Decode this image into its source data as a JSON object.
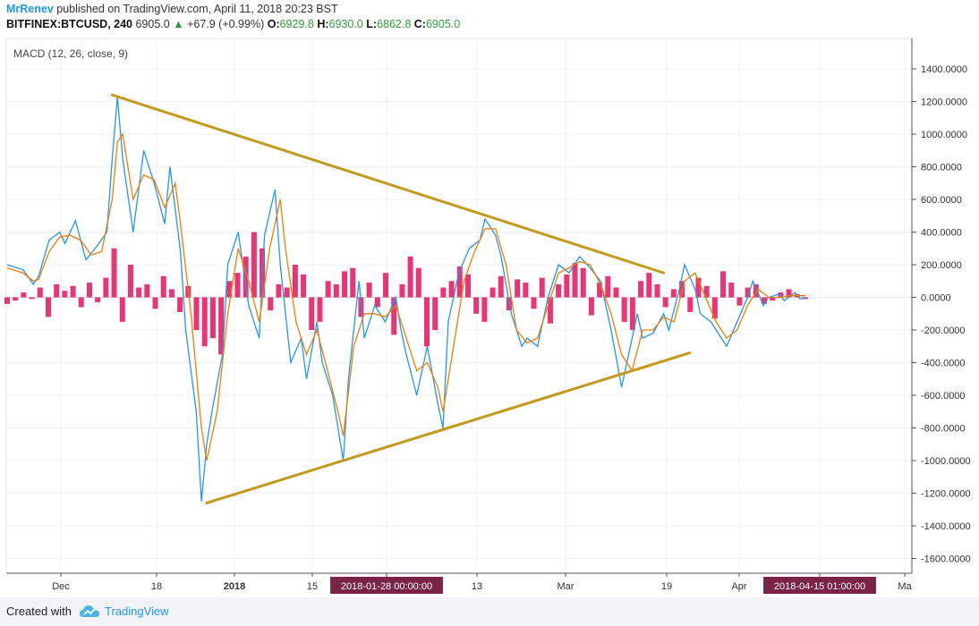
{
  "header": {
    "author": "MrRenev",
    "published": "published on TradingView.com, April 11, 2018 20:23 BST",
    "symbol": "BITFINEX:BTCUSD, 240",
    "last": "6905.0",
    "change": "+67.9 (+0.99%)",
    "o_label": "O:",
    "o": "6929.8",
    "h_label": "H:",
    "h": "6930.0",
    "l_label": "L:",
    "l": "6862.8",
    "c_label": "C:",
    "c": "6905.0"
  },
  "footer": {
    "created": "Created with",
    "brand": "TradingView"
  },
  "colors": {
    "macd": "#2196f3",
    "signal": "#f57c00",
    "histogram": "#e91e63",
    "trendline": "#c49a1c",
    "marker_bg": "#7b2346"
  },
  "chart_data": {
    "type": "line",
    "title": "MACD (12, 26, close, 9)",
    "x_ticks": [
      "Dec",
      "18",
      "2018",
      "15",
      "2018-01-28 00:00:00",
      "13",
      "Mar",
      "19",
      "Apr",
      "2018-04-15 01:00:00",
      "Ma"
    ],
    "highlighted_x_ticks": [
      "2018-01-28 00:00:00",
      "2018-04-15 01:00:00"
    ],
    "y_ticks": [
      "1400.0000",
      "1200.0000",
      "1000.0000",
      "800.0000",
      "600.0000",
      "400.0000",
      "200.0000",
      "0.0000",
      "-200.0000",
      "-400.0000",
      "-600.0000",
      "-800.0000",
      "-1000.0000",
      "-1200.0000",
      "-1400.0000",
      "-1600.0000"
    ],
    "ylim": [
      -1700,
      1550
    ],
    "grid": true,
    "series": [
      {
        "role": "macd",
        "points": [
          [
            0,
            200
          ],
          [
            3,
            170
          ],
          [
            5,
            80
          ],
          [
            6,
            130
          ],
          [
            8,
            350
          ],
          [
            10,
            400
          ],
          [
            11,
            330
          ],
          [
            13,
            470
          ],
          [
            15,
            230
          ],
          [
            17,
            310
          ],
          [
            19,
            400
          ],
          [
            20,
            850
          ],
          [
            21,
            1230
          ],
          [
            22,
            850
          ],
          [
            24,
            400
          ],
          [
            25,
            650
          ],
          [
            26,
            900
          ],
          [
            28,
            700
          ],
          [
            30,
            450
          ],
          [
            31,
            800
          ],
          [
            33,
            280
          ],
          [
            34,
            -200
          ],
          [
            36,
            -700
          ],
          [
            37,
            -1250
          ],
          [
            38,
            -900
          ],
          [
            39,
            -700
          ],
          [
            41,
            -350
          ],
          [
            42,
            200
          ],
          [
            44,
            400
          ],
          [
            46,
            -50
          ],
          [
            48,
            -250
          ],
          [
            49,
            380
          ],
          [
            51,
            660
          ],
          [
            52,
            200
          ],
          [
            54,
            -400
          ],
          [
            56,
            -250
          ],
          [
            57,
            -500
          ],
          [
            59,
            -150
          ],
          [
            60,
            -400
          ],
          [
            62,
            -600
          ],
          [
            64,
            -1000
          ],
          [
            65,
            -500
          ],
          [
            67,
            100
          ],
          [
            68,
            -250
          ],
          [
            70,
            -50
          ],
          [
            72,
            -150
          ],
          [
            74,
            0
          ],
          [
            75,
            -200
          ],
          [
            76,
            -350
          ],
          [
            78,
            -600
          ],
          [
            80,
            -300
          ],
          [
            82,
            -650
          ],
          [
            83,
            -800
          ],
          [
            84,
            -150
          ],
          [
            86,
            150
          ],
          [
            88,
            300
          ],
          [
            90,
            350
          ],
          [
            91,
            480
          ],
          [
            93,
            380
          ],
          [
            94,
            260
          ],
          [
            96,
            -100
          ],
          [
            98,
            -300
          ],
          [
            99,
            -250
          ],
          [
            101,
            -300
          ],
          [
            103,
            0
          ],
          [
            105,
            200
          ],
          [
            107,
            150
          ],
          [
            109,
            250
          ],
          [
            111,
            180
          ],
          [
            113,
            100
          ],
          [
            115,
            -200
          ],
          [
            117,
            -550
          ],
          [
            118,
            -400
          ],
          [
            120,
            -100
          ],
          [
            121,
            -250
          ],
          [
            123,
            -220
          ],
          [
            125,
            -100
          ],
          [
            126,
            -200
          ],
          [
            128,
            50
          ],
          [
            129,
            200
          ],
          [
            131,
            50
          ],
          [
            132,
            -100
          ],
          [
            134,
            -150
          ],
          [
            136,
            -250
          ],
          [
            137,
            -300
          ],
          [
            139,
            -150
          ],
          [
            141,
            0
          ],
          [
            142,
            100
          ],
          [
            144,
            -50
          ],
          [
            145,
            0
          ],
          [
            147,
            20
          ],
          [
            148,
            -20
          ],
          [
            150,
            30
          ],
          [
            151,
            -10
          ],
          [
            152,
            0
          ]
        ]
      },
      {
        "role": "signal",
        "points": [
          [
            0,
            180
          ],
          [
            3,
            150
          ],
          [
            5,
            100
          ],
          [
            6,
            110
          ],
          [
            8,
            280
          ],
          [
            10,
            370
          ],
          [
            12,
            380
          ],
          [
            14,
            350
          ],
          [
            16,
            260
          ],
          [
            18,
            280
          ],
          [
            20,
            600
          ],
          [
            21,
            950
          ],
          [
            22,
            1000
          ],
          [
            24,
            600
          ],
          [
            26,
            750
          ],
          [
            28,
            720
          ],
          [
            30,
            550
          ],
          [
            32,
            700
          ],
          [
            33,
            450
          ],
          [
            35,
            -100
          ],
          [
            37,
            -800
          ],
          [
            38,
            -1000
          ],
          [
            40,
            -700
          ],
          [
            42,
            -100
          ],
          [
            44,
            300
          ],
          [
            46,
            100
          ],
          [
            48,
            -150
          ],
          [
            50,
            300
          ],
          [
            52,
            600
          ],
          [
            53,
            300
          ],
          [
            55,
            -150
          ],
          [
            57,
            -350
          ],
          [
            59,
            -200
          ],
          [
            61,
            -450
          ],
          [
            63,
            -700
          ],
          [
            64,
            -850
          ],
          [
            66,
            -300
          ],
          [
            68,
            -100
          ],
          [
            70,
            -100
          ],
          [
            72,
            -120
          ],
          [
            74,
            -50
          ],
          [
            76,
            -250
          ],
          [
            78,
            -450
          ],
          [
            80,
            -400
          ],
          [
            82,
            -550
          ],
          [
            83,
            -700
          ],
          [
            85,
            -300
          ],
          [
            87,
            100
          ],
          [
            89,
            280
          ],
          [
            91,
            420
          ],
          [
            93,
            420
          ],
          [
            95,
            200
          ],
          [
            97,
            -200
          ],
          [
            99,
            -280
          ],
          [
            101,
            -250
          ],
          [
            103,
            -50
          ],
          [
            105,
            150
          ],
          [
            107,
            180
          ],
          [
            109,
            220
          ],
          [
            111,
            200
          ],
          [
            113,
            80
          ],
          [
            115,
            -100
          ],
          [
            117,
            -350
          ],
          [
            119,
            -450
          ],
          [
            121,
            -200
          ],
          [
            123,
            -200
          ],
          [
            125,
            -120
          ],
          [
            127,
            -150
          ],
          [
            129,
            100
          ],
          [
            131,
            150
          ],
          [
            133,
            0
          ],
          [
            135,
            -150
          ],
          [
            137,
            -250
          ],
          [
            139,
            -200
          ],
          [
            141,
            -50
          ],
          [
            143,
            50
          ],
          [
            145,
            0
          ],
          [
            147,
            0
          ],
          [
            149,
            10
          ],
          [
            152,
            10
          ]
        ]
      }
    ],
    "histogram": [
      -40,
      -20,
      30,
      -10,
      60,
      -120,
      80,
      40,
      70,
      -60,
      90,
      -30,
      120,
      300,
      -150,
      200,
      60,
      80,
      -70,
      130,
      50,
      -90,
      70,
      -200,
      -300,
      -250,
      -350,
      100,
      150,
      250,
      400,
      300,
      -80,
      80,
      60,
      200,
      140,
      -200,
      -150,
      100,
      80,
      160,
      180,
      -120,
      90,
      -60,
      150,
      -230,
      80,
      250,
      180,
      -300,
      -200,
      60,
      100,
      190,
      140,
      -100,
      -150,
      60,
      130,
      -80,
      110,
      90,
      -70,
      120,
      -160,
      80,
      140,
      210,
      180,
      -110,
      90,
      130,
      60,
      -150,
      -200,
      100,
      150,
      80,
      -60,
      50,
      100,
      -90,
      120,
      70,
      -130,
      160,
      90,
      -50,
      60,
      80,
      -40,
      -20,
      30,
      50,
      20,
      -10
    ],
    "trendlines": [
      [
        [
          20,
          1240
        ],
        [
          125,
          150
        ]
      ],
      [
        [
          38,
          -1260
        ],
        [
          130,
          -340
        ]
      ]
    ]
  }
}
